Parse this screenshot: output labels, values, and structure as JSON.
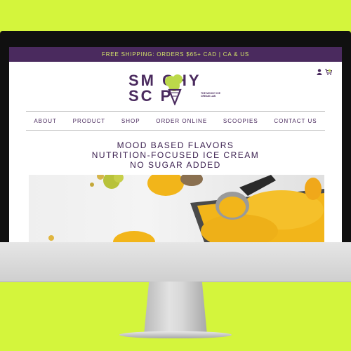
{
  "site": {
    "shipping_banner": "FREE SHIPPING: ORDERS $65+ CAD | CA & US",
    "logo": {
      "line1": "SM  CHY",
      "line2": "SC  P",
      "tagline": "THE MOODY ICE CREAM LAB"
    },
    "header_icons": [
      "user-icon",
      "cart-icon"
    ],
    "nav": [
      "ABOUT",
      "PRODUCT",
      "SHOP",
      "ORDER ONLINE",
      "SCOOPIES",
      "CONTACT US"
    ],
    "hero": {
      "line1": "MOOD BASED FLAVORS",
      "line2": "NUTRITION-FOCUSED ICE CREAM",
      "line3": "NO SUGAR ADDED"
    },
    "colors": {
      "brand_purple": "#4a2a5e",
      "brand_green": "#bcd94a",
      "ice_cream_yellow": "#f2b51a",
      "backdrop": "#d4f53c"
    }
  }
}
